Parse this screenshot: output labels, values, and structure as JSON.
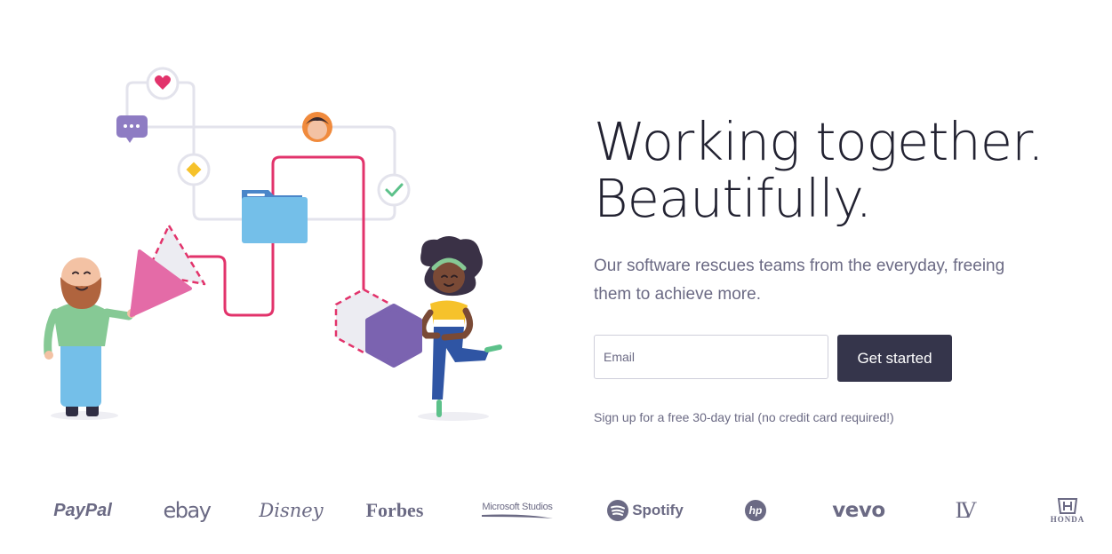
{
  "hero": {
    "headline_line1": "Working together.",
    "headline_line2": "Beautifully.",
    "subtext": "Our software rescues teams from the everyday, freeing them to achieve more.",
    "email_placeholder": "Email",
    "cta_label": "Get started",
    "trial_note": "Sign up for a free 30-day trial (no credit card required!)"
  },
  "logos": [
    {
      "name": "PayPal"
    },
    {
      "name": "ebay"
    },
    {
      "name": "Disney"
    },
    {
      "name": "Forbes"
    },
    {
      "name": "Microsoft Studios"
    },
    {
      "name": "Spotify"
    },
    {
      "name": "hp"
    },
    {
      "name": "vevo"
    },
    {
      "name": "LV"
    },
    {
      "name": "HONDA"
    }
  ],
  "colors": {
    "text_dark": "#222231",
    "text_muted": "#6b6a84",
    "button_bg": "#35354b",
    "accent_pink": "#e2336b",
    "logo_gray": "#6b6a84"
  }
}
